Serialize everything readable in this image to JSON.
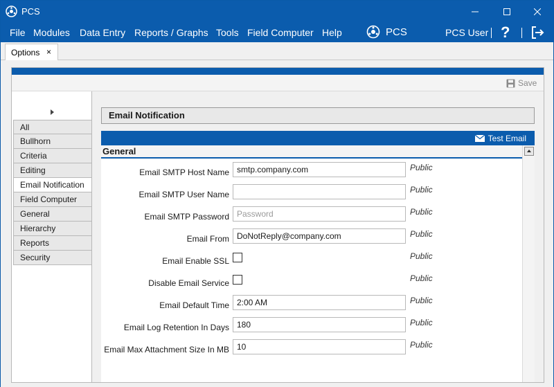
{
  "window": {
    "title": "PCS",
    "colors": {
      "accent": "#0b5cad"
    }
  },
  "menu": {
    "items": [
      "File",
      "Modules",
      "Data Entry",
      "Reports / Graphs",
      "Tools",
      "Field Computer",
      "Help"
    ],
    "brand": "PCS",
    "user": "PCS User",
    "help_label": "?"
  },
  "tabs": [
    {
      "label": "Options",
      "close": "×"
    }
  ],
  "toolbar": {
    "save_label": "Save"
  },
  "sidebar": {
    "items": [
      {
        "label": "All"
      },
      {
        "label": "Bullhorn"
      },
      {
        "label": "Criteria"
      },
      {
        "label": "Editing"
      },
      {
        "label": "Email Notification",
        "active": true
      },
      {
        "label": "Field Computer"
      },
      {
        "label": "General"
      },
      {
        "label": "Hierarchy"
      },
      {
        "label": "Reports"
      },
      {
        "label": "Security"
      }
    ]
  },
  "section": {
    "title": "Email Notification",
    "test_email_label": "Test Email",
    "group": "General"
  },
  "settings": [
    {
      "label": "Email SMTP Host Name",
      "type": "text",
      "value": "smtp.company.com",
      "scope": "Public"
    },
    {
      "label": "Email SMTP User Name",
      "type": "text",
      "value": "",
      "scope": "Public"
    },
    {
      "label": "Email SMTP Password",
      "type": "password",
      "value": "",
      "placeholder": "Password",
      "scope": "Public"
    },
    {
      "label": "Email From",
      "type": "text",
      "value": "DoNotReply@company.com",
      "scope": "Public"
    },
    {
      "label": "Email Enable SSL",
      "type": "checkbox",
      "checked": false,
      "scope": "Public"
    },
    {
      "label": "Disable Email Service",
      "type": "checkbox",
      "checked": false,
      "scope": "Public"
    },
    {
      "label": "Email Default Time",
      "type": "text",
      "value": "2:00 AM",
      "scope": "Public"
    },
    {
      "label": "Email Log Retention In Days",
      "type": "text",
      "value": "180",
      "scope": "Public"
    },
    {
      "label": "Email Max Attachment Size In MB",
      "type": "text",
      "value": "10",
      "scope": "Public"
    }
  ]
}
